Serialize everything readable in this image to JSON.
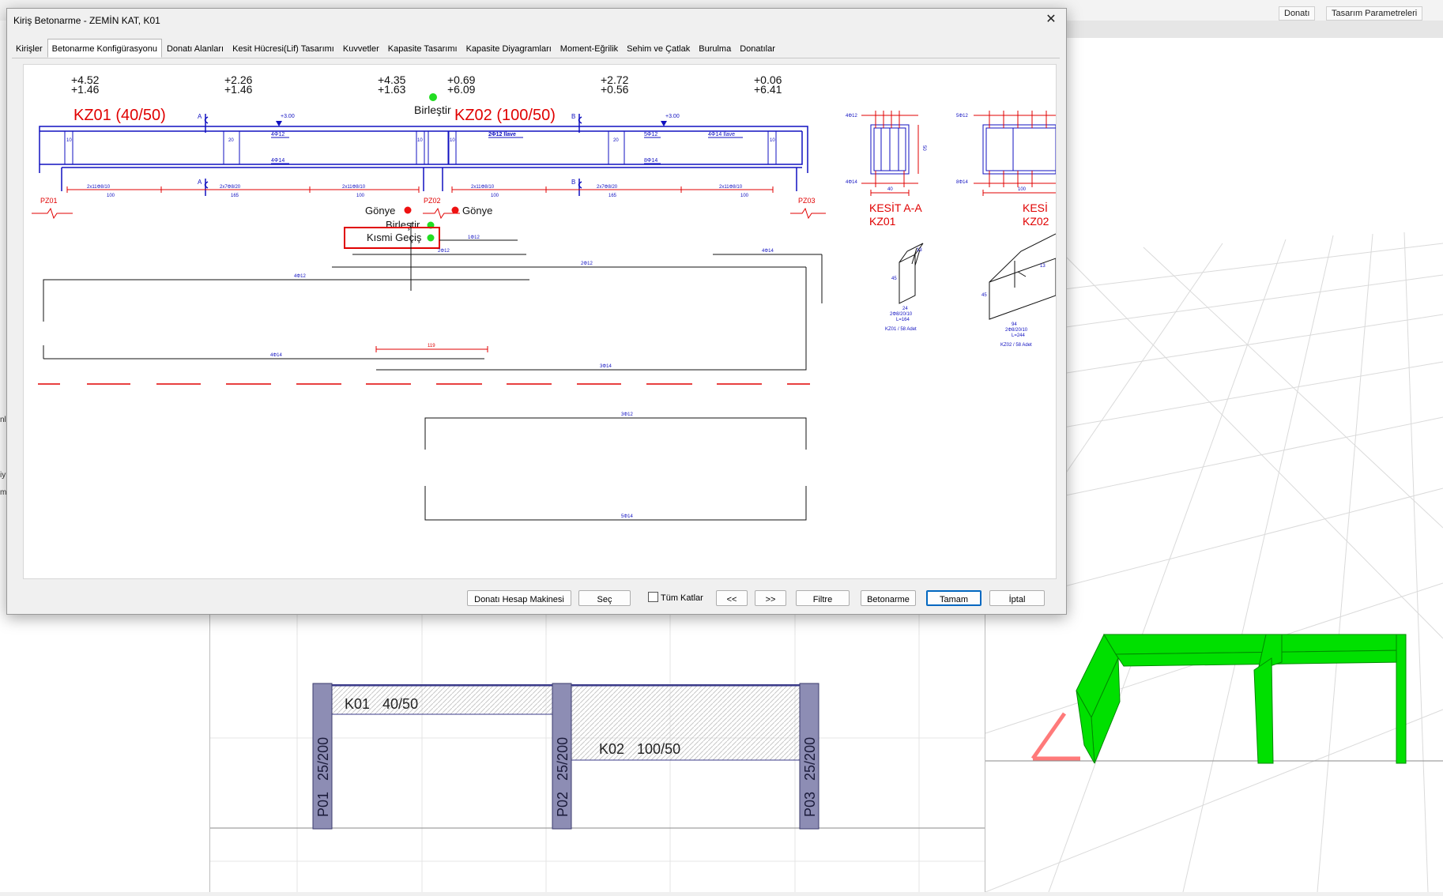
{
  "background": {
    "ribbon": [
      "Donatı",
      "Tasarım Parametreleri"
    ],
    "edge_chars": [
      "nl",
      "iy",
      "m"
    ]
  },
  "dialog": {
    "title": "Kiriş Betonarme - ZEMİN KAT, K01",
    "close_glyph": "✕",
    "tabs": [
      "Kirişler",
      "Betonarme Konfigürasyonu",
      "Donatı Alanları",
      "Kesit Hücresi(Lif) Tasarımı",
      "Kuvvetler",
      "Kapasite Tasarımı",
      "Kapasite Diyagramları",
      "Moment-Eğrilik",
      "Sehim ve Çatlak",
      "Burulma",
      "Donatılar"
    ],
    "active_tab": 1,
    "buttons": {
      "calculator": "Donatı Hesap Makinesi",
      "select": "Seç",
      "all_floors": "Tüm Katlar",
      "prev": "<<",
      "next": ">>",
      "filter": "Filtre",
      "concrete": "Betonarme",
      "ok": "Tamam",
      "cancel": "İptal"
    }
  },
  "drawing": {
    "moments": [
      {
        "top": "+4.52",
        "bottom": "+1.46"
      },
      {
        "top": "+2.26",
        "bottom": "+1.46"
      },
      {
        "top": "+4.35",
        "bottom": "+1.63"
      },
      {
        "top": "+0.69",
        "bottom": "+6.09"
      },
      {
        "top": "+2.72",
        "bottom": "+0.56"
      },
      {
        "top": "+0.06",
        "bottom": "+6.41"
      }
    ],
    "beam1_label": "KZ01 (40/50)",
    "beam2_label": "KZ02 (100/50)",
    "merge_label": "Birleştir",
    "merge_label_2": "Birleştir",
    "partial_label": "Kısmi Geçiş",
    "corner_left": "Gönye",
    "corner_right": "Gönye",
    "columns": [
      "PZ01",
      "PZ02",
      "PZ03"
    ],
    "elev_a": "+3.00",
    "elev_b": "+3.00",
    "sec_marks": [
      "A",
      "A",
      "B",
      "B"
    ],
    "top_bars": [
      "4Φ12",
      "2Φ12 İlave",
      "5Φ12",
      "4Φ14 İlave"
    ],
    "bot_bars": [
      "4Φ14",
      "8Φ14"
    ],
    "stirrups_1": [
      "2x11Φ8/10",
      "2x7Φ8/20",
      "2x11Φ8/10"
    ],
    "stirrups_2": [
      "2x11Φ8/10",
      "2x7Φ8/20",
      "2x11Φ8/10"
    ],
    "stirrup_len_1": [
      "100",
      "165",
      "100"
    ],
    "stirrup_len_2": [
      "100",
      "165",
      "100"
    ],
    "dims": [
      "10",
      "20",
      "10",
      "10",
      "20",
      "10"
    ],
    "det_bars": [
      "1Φ12",
      "2Φ12",
      "4Φ14",
      "2Φ12",
      "4Φ12",
      "119",
      "4Φ14",
      "3Φ14",
      "3Φ12",
      "5Φ14"
    ],
    "section1": {
      "title": "KESİT A-A",
      "sub": "KZ01",
      "top": "4Φ12",
      "bot": "4Φ14",
      "width": "40",
      "height": "50"
    },
    "section2": {
      "title": "KESİ",
      "sub": "KZ02",
      "top": "5Φ12",
      "bot": "8Φ14",
      "width": "100"
    },
    "stirrup1": {
      "a": "13",
      "b": "45",
      "c": "24",
      "spec": "2Φ8/20/10",
      "len": "L=164",
      "count": "KZ01 / 58 Adet"
    },
    "stirrup2": {
      "a": "13",
      "b": "45",
      "c": "94",
      "spec": "2Φ8/20/10",
      "len": "L=244",
      "count": "KZ02 / 58 Adet"
    }
  },
  "plan": {
    "beam1": {
      "name": "K01",
      "size": "40/50"
    },
    "beam2": {
      "name": "K02",
      "size": "100/50"
    },
    "columns": [
      {
        "name": "P01",
        "size": "25/200"
      },
      {
        "name": "P02",
        "size": "25/200"
      },
      {
        "name": "P03",
        "size": "25/200"
      }
    ]
  }
}
